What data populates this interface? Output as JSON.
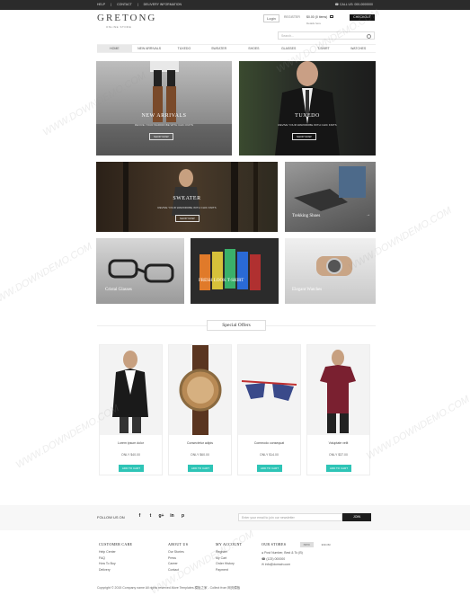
{
  "topbar": {
    "links": [
      "HELP",
      "CONTACT",
      "DELIVERY INFORMATION"
    ],
    "phone": "CALL US: 000-0000000"
  },
  "header": {
    "logo": "GRETONG",
    "tagline": "ONLINE STORE",
    "login": "Login",
    "register": "REGISTER",
    "cart_total": "$0.00 (0 items)",
    "cart_sub": "Details here",
    "checkout": "CHECKOUT",
    "search_placeholder": "Search..."
  },
  "nav": {
    "items": [
      "HOME",
      "NEW ARRIVALS",
      "TUXEDO",
      "SWEATER",
      "SHOES",
      "GLASSES",
      "T-SHIRT",
      "WATCHES"
    ],
    "active": "HOME"
  },
  "banners": {
    "new_arrivals": {
      "title": "NEW ARRIVALS",
      "sub": "REVIVE YOUR WARDROBE WITH CHIC KNITS",
      "btn": "SHOP NOW"
    },
    "tuxedo": {
      "title": "TUXEDO",
      "sub": "REVIVE YOUR WARDROBE WITH CHIC KNITS",
      "btn": "SHOP NOW"
    },
    "sweater": {
      "title": "SWEATER",
      "sub": "REVIVE YOUR WARDROBE WITH CHIC KNITS",
      "btn": "SHOP NOW"
    },
    "trekking": {
      "title": "Trekking Shoes"
    },
    "glasses": {
      "title": "Cristal Glasses"
    },
    "tshirts": {
      "title": "FRESH LOOK T-SHIRT"
    },
    "watches": {
      "title": "Elegant Watches"
    }
  },
  "special_offers": {
    "title": "Special Offers",
    "products": [
      {
        "name": "Lorem ipsum dolor",
        "price": "ONLY $40.00",
        "btn": "ADD TO CART"
      },
      {
        "name": "Consectetur adipis",
        "price": "ONLY $60.00",
        "btn": "ADD TO CART"
      },
      {
        "name": "Commodo consequat",
        "price": "ONLY $14.00",
        "btn": "ADD TO CART"
      },
      {
        "name": "Voluptate velit",
        "price": "ONLY $37.00",
        "btn": "ADD TO CART"
      }
    ]
  },
  "follow": {
    "label": "FOLLOW US ON",
    "socials": [
      "f",
      "t",
      "g+",
      "in",
      "p"
    ],
    "newsletter_placeholder": "Enter your email to join our newsletter",
    "join": "JOIN"
  },
  "footer": {
    "customer_care": {
      "head": "CUSTOMER CARE",
      "links": [
        "Help Center",
        "FAQ",
        "How To Buy",
        "Delivery"
      ]
    },
    "about": {
      "head": "ABOUT US",
      "links": [
        "Our Stories",
        "Press",
        "Career",
        "Contact"
      ]
    },
    "account": {
      "head": "MY ACCOUNT",
      "links": [
        "Register",
        "My Cart",
        "Order History",
        "Payment"
      ]
    },
    "stores": {
      "head": "OUR STORES",
      "tabs": [
        "NEW",
        "ROOM"
      ],
      "address": "Post Number, Best & To (B)",
      "phone": "(123) 000000",
      "email": "info@domain.com"
    }
  },
  "copyright": "Copyright © 2015 Company name All rights reserved.More Templates 模板之家 - Collect from 网页模板",
  "watermark": "WWW.DOWNDEMO.COM",
  "colors": {
    "accent": "#2ec4b6",
    "dark": "#1e1e1e"
  }
}
